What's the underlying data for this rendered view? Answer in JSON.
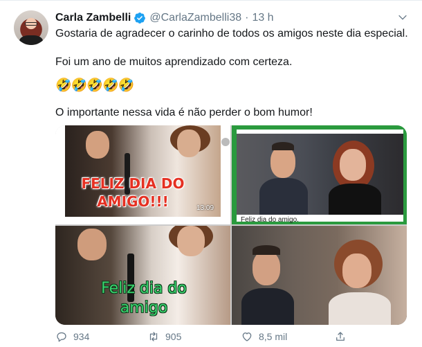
{
  "tweet": {
    "author_name": "Carla Zambelli",
    "handle": "@CarlaZambelli38",
    "separator": "·",
    "time": "13 h",
    "lines": [
      "Gostaria de agradecer o carinho de todos os amigos neste dia especial.",
      "Foi um ano de muitos aprendizado com certeza.",
      "🤣🤣🤣🤣🤣",
      "O importante nessa vida é não perder o bom humor!"
    ]
  },
  "media": {
    "image1": {
      "overlay_line1": "FELIZ DIA DO",
      "overlay_line2": "AMIGO!!!",
      "timestamp": "13:09"
    },
    "image2": {
      "caption": "Feliz dia do amigo."
    },
    "image3": {
      "overlay_line1": "Feliz dia do",
      "overlay_line2": "amigo"
    }
  },
  "actions": {
    "reply_count": "934",
    "retweet_count": "905",
    "like_count": "8,5 mil"
  },
  "colors": {
    "text": "#14171a",
    "secondary": "#657786",
    "verified": "#1da1f2",
    "overlay_red": "#e53022",
    "overlay_green": "#39d36e"
  },
  "icons": [
    "verified-badge-icon",
    "chevron-down-icon",
    "reply-icon",
    "retweet-icon",
    "like-icon",
    "share-icon"
  ]
}
